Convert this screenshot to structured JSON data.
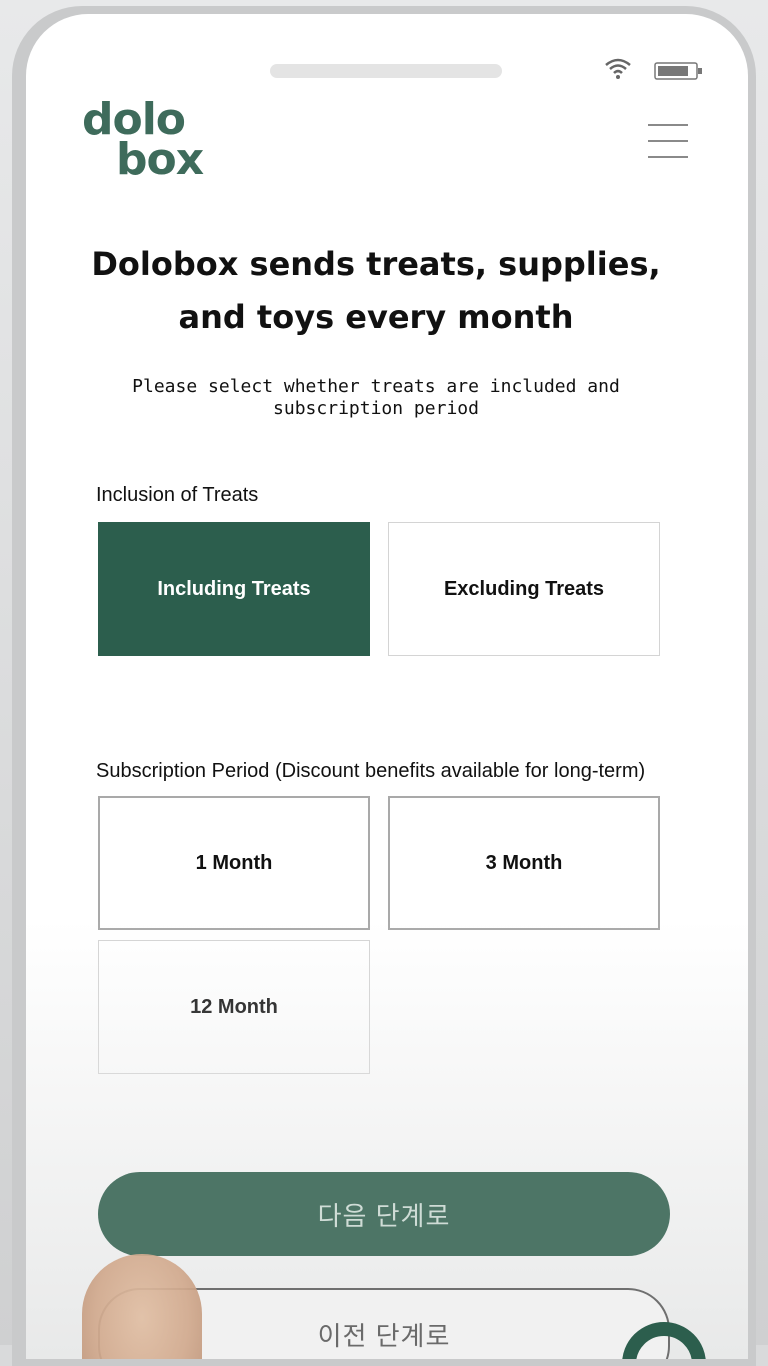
{
  "header": {
    "logo_line1": "dolo",
    "logo_line2": "box",
    "menu_icon": "hamburger-icon"
  },
  "status_bar": {
    "wifi_icon": "wifi-icon",
    "battery_icon": "battery-icon"
  },
  "main": {
    "headline": "Dolobox sends treats, supplies, and toys every month",
    "subtext": "Please select whether treats are included and subscription period"
  },
  "treats": {
    "label": "Inclusion of Treats",
    "options": [
      "Including Treats",
      "Excluding Treats"
    ],
    "selected": "Including Treats"
  },
  "period": {
    "label": "Subscription Period (Discount benefits available for long-term)",
    "options": [
      "1 Month",
      "3 Month",
      "12 Month"
    ]
  },
  "footer": {
    "next_label": "다음 단계로",
    "prev_label": "이전 단계로"
  },
  "colors": {
    "brand": "#3e6b5b",
    "selected_bg": "#2c5e4d",
    "next_button": "#4d7566"
  }
}
